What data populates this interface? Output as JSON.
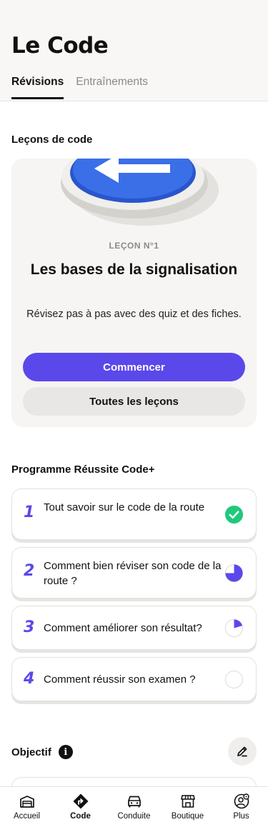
{
  "header": {
    "title": "Le Code",
    "tabs": [
      {
        "label": "Révisions",
        "active": true
      },
      {
        "label": "Entraînements",
        "active": false
      }
    ]
  },
  "lessons": {
    "section_title": "Leçons de code",
    "card": {
      "kicker": "LEÇON N°1",
      "title": "Les bases de la signalisation",
      "description": "Révisez pas à pas avec des quiz et des fiches.",
      "primary_button": "Commencer",
      "secondary_button": "Toutes les leçons",
      "illustration_icon": "road-sign-arrow-left-icon"
    }
  },
  "programme": {
    "section_title": "Programme Réussite Code+",
    "items": [
      {
        "number": "1",
        "label": "Tout savoir sur le code de la route",
        "status": "completed",
        "progress": 1.0
      },
      {
        "number": "2",
        "label": "Comment bien réviser son code de la route ?",
        "status": "in-progress",
        "progress": 0.75
      },
      {
        "number": "3",
        "label": "Comment améliorer son résultat?",
        "status": "in-progress",
        "progress": 0.2
      },
      {
        "number": "4",
        "label": "Comment réussir son examen ?",
        "status": "not-started",
        "progress": 0.0
      }
    ]
  },
  "objectif": {
    "title": "Objectif",
    "info_icon": "i"
  },
  "tabbar": {
    "items": [
      {
        "label": "Accueil",
        "icon": "garage-icon",
        "active": false
      },
      {
        "label": "Code",
        "icon": "road-sign-icon",
        "active": true
      },
      {
        "label": "Conduite",
        "icon": "car-icon",
        "active": false
      },
      {
        "label": "Boutique",
        "icon": "shop-icon",
        "active": false
      },
      {
        "label": "Plus",
        "icon": "user-settings-icon",
        "active": false
      }
    ]
  },
  "colors": {
    "accent": "#5b48ea",
    "success": "#1fc87d",
    "sign_blue": "#3a6fe8"
  }
}
